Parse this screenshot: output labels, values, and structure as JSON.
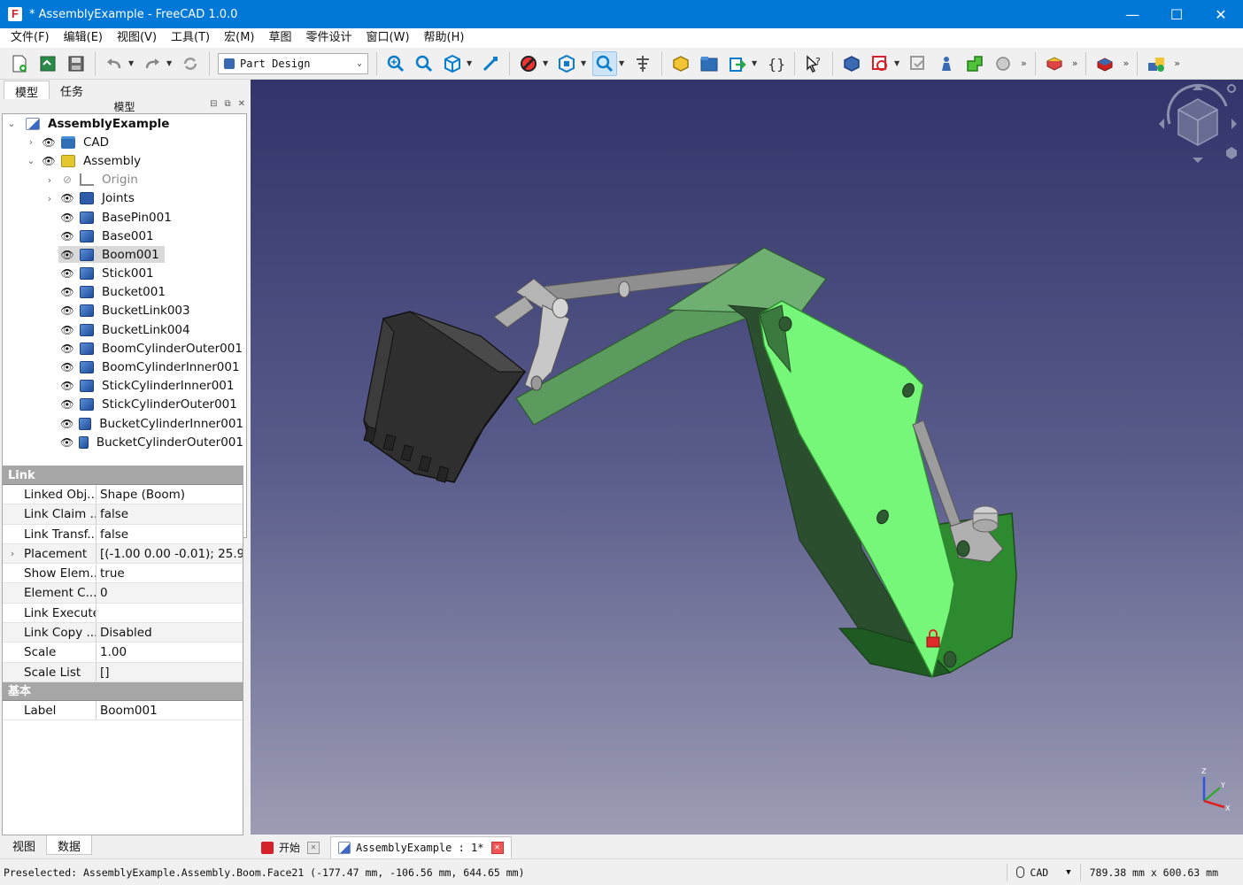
{
  "window": {
    "title": "* AssemblyExample - FreeCAD 1.0.0",
    "app_icon_letter": "F",
    "controls": {
      "minimize": "—",
      "maximize": "☐",
      "close": "✕"
    }
  },
  "menubar": [
    "文件(F)",
    "编辑(E)",
    "视图(V)",
    "工具(T)",
    "宏(M)",
    "草图",
    "零件设计",
    "窗口(W)",
    "帮助(H)"
  ],
  "toolbar": {
    "workbench": "Part Design",
    "more_glyph": "»"
  },
  "left_panel": {
    "tabs": [
      "模型",
      "任务"
    ],
    "dock_title": "模型",
    "bottom_tabs": [
      "视图",
      "数据"
    ]
  },
  "tree": {
    "root": "AssemblyExample",
    "items": [
      {
        "label": "CAD",
        "level": 1,
        "expander": "›",
        "icon": "folder-icon"
      },
      {
        "label": "Assembly",
        "level": 1,
        "expander": "⌄",
        "icon": "assembly-icon"
      },
      {
        "label": "Origin",
        "level": 2,
        "expander": "›",
        "icon": "origin-icon",
        "hidden": true
      },
      {
        "label": "Joints",
        "level": 2,
        "expander": "›",
        "icon": "joints-icon"
      },
      {
        "label": "BasePin001",
        "level": 2,
        "icon": "body-icon"
      },
      {
        "label": "Base001",
        "level": 2,
        "icon": "body-icon"
      },
      {
        "label": "Boom001",
        "level": 2,
        "icon": "body-icon",
        "selected": true
      },
      {
        "label": "Stick001",
        "level": 2,
        "icon": "body-icon"
      },
      {
        "label": "Bucket001",
        "level": 2,
        "icon": "body-icon"
      },
      {
        "label": "BucketLink003",
        "level": 2,
        "icon": "body-icon"
      },
      {
        "label": "BucketLink004",
        "level": 2,
        "icon": "body-icon"
      },
      {
        "label": "BoomCylinderOuter001",
        "level": 2,
        "icon": "body-icon"
      },
      {
        "label": "BoomCylinderInner001",
        "level": 2,
        "icon": "body-icon"
      },
      {
        "label": "StickCylinderInner001",
        "level": 2,
        "icon": "body-icon"
      },
      {
        "label": "StickCylinderOuter001",
        "level": 2,
        "icon": "body-icon"
      },
      {
        "label": "BucketCylinderInner001",
        "level": 2,
        "icon": "body-icon"
      },
      {
        "label": "BucketCylinderOuter001",
        "level": 2,
        "icon": "body-icon"
      }
    ]
  },
  "properties": {
    "group_link": "Link",
    "link_rows": [
      {
        "name": "Linked Obj...",
        "value": "Shape (Boom)"
      },
      {
        "name": "Link Claim ...",
        "value": "false"
      },
      {
        "name": "Link Transf...",
        "value": "false"
      },
      {
        "name": "Placement",
        "value": "[(-1.00 0.00 -0.01); 25.9...",
        "expandable": true
      },
      {
        "name": "Show Elem...",
        "value": "true"
      },
      {
        "name": "Element C...",
        "value": "0"
      },
      {
        "name": "Link Execute",
        "value": ""
      },
      {
        "name": "Link Copy ...",
        "value": "Disabled"
      },
      {
        "name": "Scale",
        "value": "1.00"
      },
      {
        "name": "Scale List",
        "value": "[]"
      }
    ],
    "group_base": "基本",
    "base_rows": [
      {
        "name": "Label",
        "value": "Boom001"
      }
    ]
  },
  "doc_tabs": [
    {
      "label": "开始",
      "active": false
    },
    {
      "label": "AssemblyExample : 1*",
      "active": true
    }
  ],
  "navcube": {
    "axis_labels": {
      "z": "Z",
      "y": "Y",
      "x": "X"
    }
  },
  "statusbar": {
    "preselected": "Preselected: AssemblyExample.Assembly.Boom.Face21 (-177.47 mm, -106.56 mm, 644.65 mm)",
    "nav_style": "CAD",
    "dimensions": "789.38 mm x 600.63 mm"
  },
  "colors": {
    "titlebar": "#0078d7",
    "boom_highlight": "#77f77a",
    "stick_green": "#5a9a5e",
    "base_green": "#2f8a2f",
    "bucket_dark": "#2b2b2b",
    "selected_row": "#d9d9d9"
  }
}
